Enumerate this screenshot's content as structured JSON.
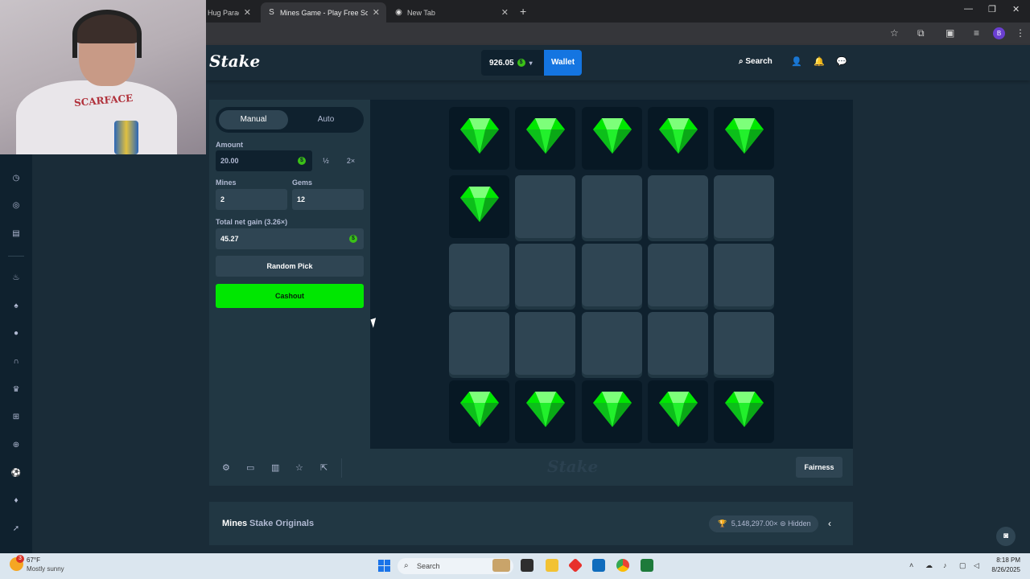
{
  "browser": {
    "tabs": [
      {
        "title": "Hug Paradise",
        "favicon": "grid-icon"
      },
      {
        "title": "Mines Game - Play Free Social Casino",
        "favicon": "stake-icon"
      },
      {
        "title": "New Tab",
        "favicon": "chrome-icon"
      }
    ],
    "tab_close": "✕",
    "new_tab": "+",
    "window_controls": [
      "—",
      "❐",
      "✕"
    ],
    "profile_initial": "B"
  },
  "header": {
    "logo": "Stake",
    "balance": "926.05",
    "currency_symbol": "$",
    "wallet_label": "Wallet",
    "search_label": "Search"
  },
  "controls": {
    "tabs": [
      "Manual",
      "Auto"
    ],
    "active_tab": "Manual",
    "amount_label": "Amount",
    "amount_value": "20.00",
    "half_label": "½",
    "double_label": "2×",
    "mines_label": "Mines",
    "mines_value": "2",
    "gems_label": "Gems",
    "gems_value": "12",
    "net_gain_label": "Total net gain (3.26×)",
    "net_gain_value": "45.27",
    "random_pick_label": "Random Pick",
    "cashout_label": "Cashout"
  },
  "board": {
    "rows": 5,
    "cols": 5,
    "tiles": [
      "gem",
      "gem",
      "gem",
      "gem",
      "gem",
      "gem",
      "closed",
      "closed",
      "closed",
      "closed",
      "closed",
      "closed",
      "closed",
      "closed",
      "closed",
      "closed",
      "closed",
      "closed",
      "closed",
      "closed",
      "gem",
      "gem",
      "gem",
      "gem",
      "gem"
    ],
    "gem_color": "#00e701"
  },
  "footer": {
    "icons": [
      "gear-icon",
      "theatre-icon",
      "stats-icon",
      "star-icon",
      "popout-icon"
    ],
    "watermark": "Stake",
    "fairness_label": "Fairness"
  },
  "info": {
    "game_name": "Mines",
    "provider": "Stake Originals",
    "max_win": "5,148,297.00×",
    "hidden_label": "Hidden"
  },
  "webcam": {
    "shirt_text": "SCARFACE"
  },
  "taskbar": {
    "weather_temp": "67°F",
    "weather_desc": "Mostly sunny",
    "weather_badge": "3",
    "search_placeholder": "Search",
    "time": "8:18 PM",
    "date": "8/26/2025"
  },
  "colors": {
    "bg": "#1a2c38",
    "panel": "#213743",
    "tile": "#2f4553",
    "accent_green": "#00e701",
    "wallet_blue": "#1475e1"
  }
}
